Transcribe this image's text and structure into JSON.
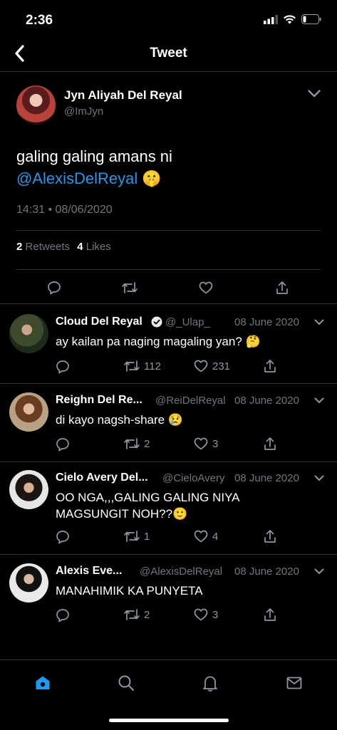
{
  "status": {
    "time": "2:36"
  },
  "header": {
    "title": "Tweet"
  },
  "tweet": {
    "author_name": "Jyn Aliyah Del Reyal",
    "author_handle": "@ImJyn",
    "text_line1": "galing galing amans ni",
    "mention": "@AlexisDelReyal",
    "emoji": "🤫",
    "timestamp": "14:31 • 08/06/2020",
    "retweets_count": "2",
    "retweets_label": "Retweets",
    "likes_count": "4",
    "likes_label": "Likes"
  },
  "replies": [
    {
      "name": "Cloud Del Reyal",
      "handle": "@_Ulap_",
      "date": "08 June 2020",
      "text": "ay kailan pa naging magaling yan? 🤔",
      "retweets": "112",
      "likes": "231",
      "verified": true
    },
    {
      "name": "Reighn Del Re...",
      "handle": "@ReiDelReyal",
      "date": "08 June 2020",
      "text": "di kayo nagsh-share 😢",
      "retweets": "2",
      "likes": "3",
      "verified": false
    },
    {
      "name": "Cielo Avery Del...",
      "handle": "@CieloAvery",
      "date": "08 June 2020",
      "text_line1": "OO NGA,,,GALING GALING NIYA",
      "text_line2": "MAGSUNGIT NOH??🙂",
      "retweets": "1",
      "likes": "4",
      "verified": false
    },
    {
      "name": "Alexis Eve...",
      "handle": "@AlexisDelReyal",
      "date": "08 June 2020",
      "text": "MANAHIMIK KA PUNYETA",
      "retweets": "2",
      "likes": "3",
      "verified": false
    }
  ],
  "tabs": [
    {
      "icon": "home-icon",
      "active": true
    },
    {
      "icon": "search-icon",
      "active": false
    },
    {
      "icon": "bell-icon",
      "active": false
    },
    {
      "icon": "mail-icon",
      "active": false
    }
  ],
  "colors": {
    "accent": "#1d9bf0",
    "background": "#000000",
    "muted": "#6e767d"
  }
}
